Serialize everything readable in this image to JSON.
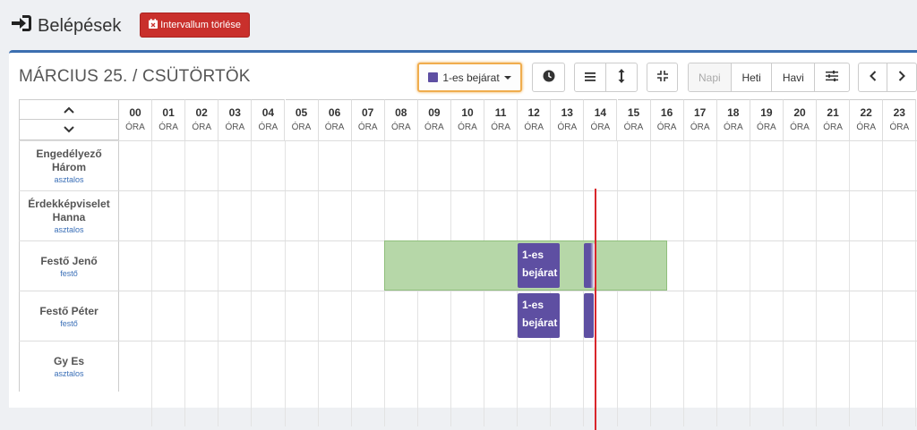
{
  "header": {
    "title": "Belépések",
    "clear_button": "Intervallum törlése"
  },
  "toolbar": {
    "date": "MÁRCIUS 25. / CSÜTÖRTÖK",
    "entrance": "1-es bejárat",
    "entrance_color": "#5e4fa2",
    "view_day": "Napi",
    "view_week": "Heti",
    "view_month": "Havi"
  },
  "hours": [
    "00",
    "01",
    "02",
    "03",
    "04",
    "05",
    "06",
    "07",
    "08",
    "09",
    "10",
    "11",
    "12",
    "13",
    "14",
    "15",
    "16",
    "17",
    "18",
    "19",
    "20",
    "21",
    "22",
    "23"
  ],
  "hour_unit": "ÓRA",
  "rows": [
    {
      "name": "Engedélyező Három",
      "role": "asztalos"
    },
    {
      "name": "Érdekképviselet Hanna",
      "role": "asztalos"
    },
    {
      "name": "Festő Jenő",
      "role": "festő"
    },
    {
      "name": "Festő Péter",
      "role": "festő"
    },
    {
      "name": "Gy Es",
      "role": "asztalos"
    }
  ],
  "events": [
    {
      "label": "1-es bejárat"
    },
    {
      "label": "1-es bejárat"
    }
  ],
  "colors": {
    "accent": "#3c6fb0",
    "danger": "#c9302c",
    "interval": "#b6d7a8",
    "now": "#d9262b"
  }
}
